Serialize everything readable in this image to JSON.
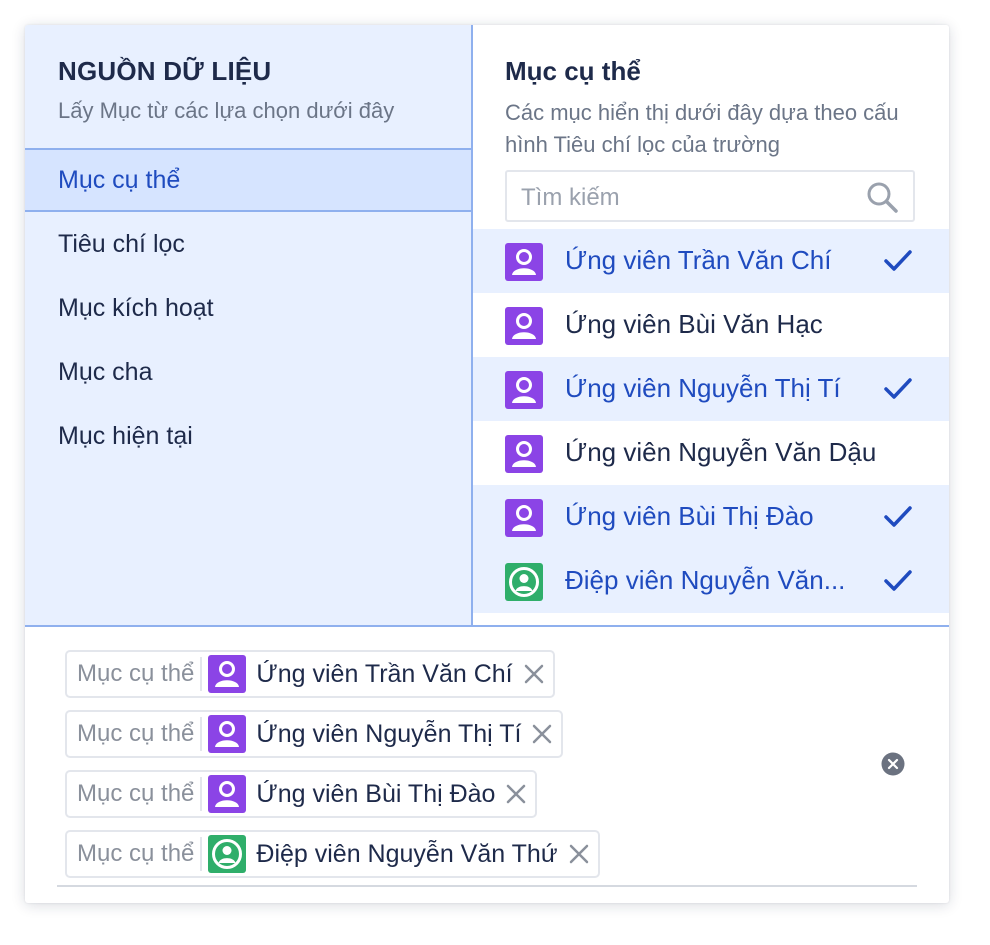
{
  "source_panel": {
    "title": "NGUỒN DỮ LIỆU",
    "subtitle": "Lấy Mục từ các lựa chọn dưới đây",
    "options": [
      {
        "label": "Mục cụ thể",
        "active": true
      },
      {
        "label": "Tiêu chí lọc",
        "active": false
      },
      {
        "label": "Mục kích hoạt",
        "active": false
      },
      {
        "label": "Mục cha",
        "active": false
      },
      {
        "label": "Mục hiện tại",
        "active": false
      }
    ]
  },
  "detail_panel": {
    "title": "Mục cụ thể",
    "subtitle": "Các mục hiển thị dưới đây dựa theo cấu hình Tiêu chí lọc của trường",
    "search_placeholder": "Tìm kiếm",
    "items": [
      {
        "name": "Ứng viên Trần Văn Chí",
        "selected": true,
        "avatar": "user-icon",
        "color": "#8b44e6"
      },
      {
        "name": "Ứng viên Bùi Văn Hạc",
        "selected": false,
        "avatar": "user-icon",
        "color": "#8b44e6"
      },
      {
        "name": "Ứng viên Nguyễn Thị Tí",
        "selected": true,
        "avatar": "user-icon",
        "color": "#8b44e6"
      },
      {
        "name": "Ứng viên Nguyễn Văn Dậu",
        "selected": false,
        "avatar": "user-icon",
        "color": "#8b44e6"
      },
      {
        "name": "Ứng viên Bùi Thị Đào",
        "selected": true,
        "avatar": "user-icon",
        "color": "#8b44e6"
      },
      {
        "name": "Điệp viên Nguyễn Văn...",
        "selected": true,
        "avatar": "user-circle-icon",
        "color": "#2fae6a"
      }
    ]
  },
  "selection": {
    "tags": [
      {
        "prefix": "Mục cụ thể",
        "name": "Ứng viên Trần Văn Chí",
        "avatar": "user-icon",
        "color": "#8b44e6"
      },
      {
        "prefix": "Mục cụ thể",
        "name": "Ứng viên Nguyễn Thị Tí",
        "avatar": "user-icon",
        "color": "#8b44e6"
      },
      {
        "prefix": "Mục cụ thể",
        "name": "Ứng viên Bùi Thị Đào",
        "avatar": "user-icon",
        "color": "#8b44e6"
      },
      {
        "prefix": "Mục cụ thể",
        "name": "Điệp viên Nguyễn Văn Thứ",
        "avatar": "user-circle-icon",
        "color": "#2fae6a"
      }
    ]
  },
  "colors": {
    "accent": "#1f4bbf",
    "panel_bg": "#e8f0ff",
    "border": "#8fb0ee",
    "purple_avatar": "#8b44e6",
    "green_avatar": "#2fae6a"
  }
}
